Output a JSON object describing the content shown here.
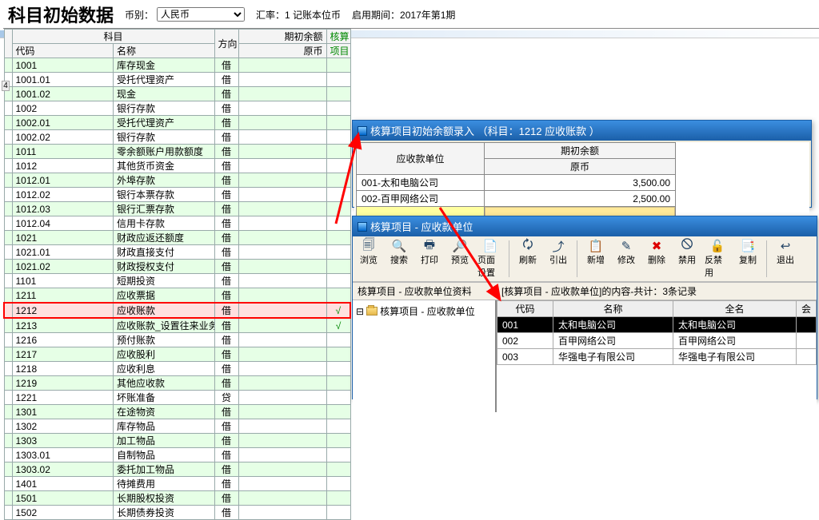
{
  "header": {
    "title": "科目初始数据",
    "currency_label": "币别：",
    "currency_value": "人民币",
    "rate_label": "汇率：1 记账本位币",
    "period_label": "启用期间：2017年第1期"
  },
  "tableHead": {
    "group_account": "科目",
    "group_balance": "期初余额",
    "group_acct": "核算",
    "code": "代码",
    "name": "名称",
    "dir": "方向",
    "orig": "原币",
    "item": "项目",
    "row_marker": "4"
  },
  "rows": [
    {
      "code": "1001",
      "name": "库存现金",
      "dir": "借",
      "bal": "",
      "acct": ""
    },
    {
      "code": "1001.01",
      "name": "受托代理资产",
      "dir": "借",
      "bal": "",
      "acct": ""
    },
    {
      "code": "1001.02",
      "name": "现金",
      "dir": "借",
      "bal": "",
      "acct": ""
    },
    {
      "code": "1002",
      "name": "银行存款",
      "dir": "借",
      "bal": "",
      "acct": ""
    },
    {
      "code": "1002.01",
      "name": "受托代理资产",
      "dir": "借",
      "bal": "",
      "acct": ""
    },
    {
      "code": "1002.02",
      "name": "银行存款",
      "dir": "借",
      "bal": "",
      "acct": ""
    },
    {
      "code": "1011",
      "name": "零余额账户用款额度",
      "dir": "借",
      "bal": "",
      "acct": ""
    },
    {
      "code": "1012",
      "name": "其他货币资金",
      "dir": "借",
      "bal": "",
      "acct": ""
    },
    {
      "code": "1012.01",
      "name": "外埠存款",
      "dir": "借",
      "bal": "",
      "acct": ""
    },
    {
      "code": "1012.02",
      "name": "银行本票存款",
      "dir": "借",
      "bal": "",
      "acct": ""
    },
    {
      "code": "1012.03",
      "name": "银行汇票存款",
      "dir": "借",
      "bal": "",
      "acct": ""
    },
    {
      "code": "1012.04",
      "name": "信用卡存款",
      "dir": "借",
      "bal": "",
      "acct": ""
    },
    {
      "code": "1021",
      "name": "财政应返还额度",
      "dir": "借",
      "bal": "",
      "acct": ""
    },
    {
      "code": "1021.01",
      "name": "财政直接支付",
      "dir": "借",
      "bal": "",
      "acct": ""
    },
    {
      "code": "1021.02",
      "name": "财政授权支付",
      "dir": "借",
      "bal": "",
      "acct": ""
    },
    {
      "code": "1101",
      "name": "短期投资",
      "dir": "借",
      "bal": "",
      "acct": ""
    },
    {
      "code": "1211",
      "name": "应收票据",
      "dir": "借",
      "bal": "",
      "acct": ""
    },
    {
      "code": "1212",
      "name": "应收账款",
      "dir": "借",
      "bal": "",
      "acct": "√",
      "hl": true
    },
    {
      "code": "1213",
      "name": "应收账款_设置往来业务核算",
      "dir": "借",
      "bal": "",
      "acct": "√"
    },
    {
      "code": "1216",
      "name": "预付账款",
      "dir": "借",
      "bal": "",
      "acct": ""
    },
    {
      "code": "1217",
      "name": "应收股利",
      "dir": "借",
      "bal": "",
      "acct": ""
    },
    {
      "code": "1218",
      "name": "应收利息",
      "dir": "借",
      "bal": "",
      "acct": ""
    },
    {
      "code": "1219",
      "name": "其他应收款",
      "dir": "借",
      "bal": "",
      "acct": ""
    },
    {
      "code": "1221",
      "name": "坏账准备",
      "dir": "贷",
      "bal": "",
      "acct": ""
    },
    {
      "code": "1301",
      "name": "在途物资",
      "dir": "借",
      "bal": "",
      "acct": ""
    },
    {
      "code": "1302",
      "name": "库存物品",
      "dir": "借",
      "bal": "",
      "acct": ""
    },
    {
      "code": "1303",
      "name": "加工物品",
      "dir": "借",
      "bal": "",
      "acct": ""
    },
    {
      "code": "1303.01",
      "name": "自制物品",
      "dir": "借",
      "bal": "",
      "acct": ""
    },
    {
      "code": "1303.02",
      "name": "委托加工物品",
      "dir": "借",
      "bal": "",
      "acct": ""
    },
    {
      "code": "1401",
      "name": "待摊费用",
      "dir": "借",
      "bal": "",
      "acct": ""
    },
    {
      "code": "1501",
      "name": "长期股权投资",
      "dir": "借",
      "bal": "",
      "acct": ""
    },
    {
      "code": "1502",
      "name": "长期债券投资",
      "dir": "借",
      "bal": "",
      "acct": ""
    }
  ],
  "win1": {
    "title": "核算项目初始余额录入 （科目：1212 应收账款 ）",
    "col_unit": "应收款单位",
    "col_bal_group": "期初余额",
    "col_orig": "原币",
    "rows": [
      {
        "unit": "001-太和电脑公司",
        "amt": "3,500.00"
      },
      {
        "unit": "002-百甲网络公司",
        "amt": "2,500.00"
      }
    ]
  },
  "win2": {
    "title": "核算项目 - 应收款单位",
    "toolbar": [
      {
        "label": "浏览",
        "icon": "🗐",
        "name": "browse"
      },
      {
        "label": "搜索",
        "icon": "🔍",
        "name": "search"
      },
      {
        "label": "打印",
        "icon": "🖶",
        "name": "print"
      },
      {
        "label": "预览",
        "icon": "🔎",
        "name": "preview"
      },
      {
        "label": "页面设置",
        "icon": "📄",
        "name": "page-setup"
      },
      {
        "sep": true
      },
      {
        "label": "刷新",
        "icon": "🗘",
        "name": "refresh"
      },
      {
        "label": "引出",
        "icon": "⤴",
        "name": "export"
      },
      {
        "sep": true
      },
      {
        "label": "新增",
        "icon": "📋",
        "name": "add"
      },
      {
        "label": "修改",
        "icon": "✎",
        "name": "edit"
      },
      {
        "label": "删除",
        "icon": "✖",
        "name": "delete",
        "color": "#d00"
      },
      {
        "label": "禁用",
        "icon": "🛇",
        "name": "disable"
      },
      {
        "label": "反禁用",
        "icon": "🔓",
        "name": "enable"
      },
      {
        "label": "复制",
        "icon": "📑",
        "name": "copy"
      },
      {
        "sep": true
      },
      {
        "label": "退出",
        "icon": "↩",
        "name": "exit"
      }
    ],
    "status_left": "核算项目 - 应收款单位资料",
    "status_right": "[核算项目 - 应收款单位]的内容-共计：3条记录",
    "tree_root": "核算项目 - 应收款单位",
    "grid_cols": {
      "code": "代码",
      "name": "名称",
      "full": "全名",
      "ext": "会"
    },
    "grid_rows": [
      {
        "code": "001",
        "name": "太和电脑公司",
        "full": "太和电脑公司",
        "sel": true
      },
      {
        "code": "002",
        "name": "百甲网络公司",
        "full": "百甲网络公司"
      },
      {
        "code": "003",
        "name": "华强电子有限公司",
        "full": "华强电子有限公司"
      }
    ]
  }
}
